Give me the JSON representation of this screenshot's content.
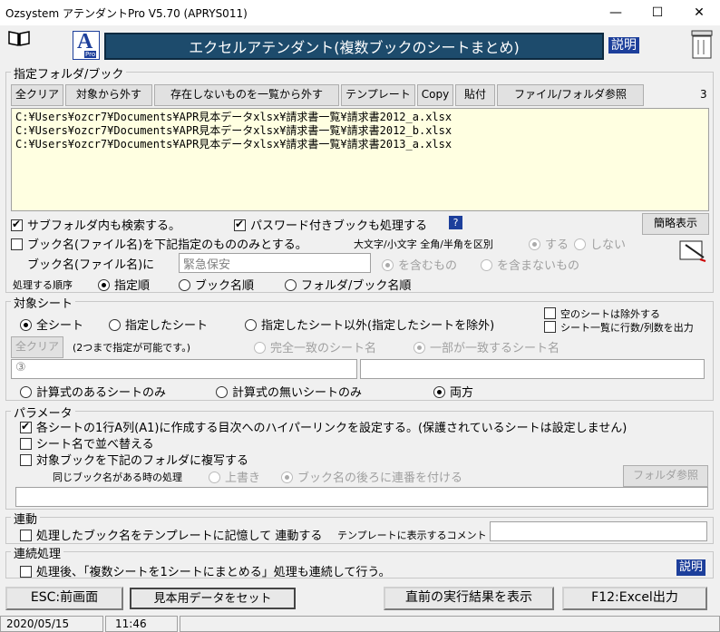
{
  "window": {
    "title": "Ozsystem アテンダントPro V5.70 (APRYS011)",
    "minimize": "—",
    "maximize": "☐",
    "close": "✕"
  },
  "header": {
    "banner": "エクセルアテンダント(複数ブックのシートまとめ)",
    "help_label": "説明",
    "logo_letter": "A",
    "logo_sub": "Pro"
  },
  "folder_section": {
    "label": "指定フォルダ/ブック",
    "buttons": [
      "全クリア",
      "対象から外す",
      "存在しないものを一覧から外す",
      "テンプレート",
      "Copy",
      "貼付",
      "ファイル/フォルダ参照"
    ],
    "count": "3",
    "files": [
      "C:¥Users¥ozcr7¥Documents¥APR見本データxlsx¥請求書一覧¥請求書2012_a.xlsx",
      "C:¥Users¥ozcr7¥Documents¥APR見本データxlsx¥請求書一覧¥請求書2012_b.xlsx",
      "C:¥Users¥ozcr7¥Documents¥APR見本データxlsx¥請求書一覧¥請求書2013_a.xlsx"
    ],
    "subfolder_search": "サブフォルダ内も検索する。",
    "password_books": "パスワード付きブックも処理する",
    "help_q": "?",
    "compact_button": "簡略表示",
    "name_only": "ブック名(ファイル名)を下記指定のもののみとする。",
    "case_label": "大文字/小文字 全角/半角を区別",
    "case_yes": "する",
    "case_no": "しない",
    "bookname_label": "ブック名(ファイル名)に",
    "bookname_value": "緊急保安",
    "contains": "を含むもの",
    "not_contains": "を含まないもの",
    "order_label": "処理する順序",
    "order_options": [
      "指定順",
      "ブック名順",
      "フォルダ/ブック名順"
    ]
  },
  "sheet_section": {
    "label": "対象シート",
    "all": "全シート",
    "specified": "指定したシート",
    "except": "指定したシート以外(指定したシートを除外)",
    "exclude_empty": "空のシートは除外する",
    "output_counts": "シート一覧に行数/列数を出力",
    "clear_button": "全クリア",
    "two_note": "(2つまで指定が可能です。)",
    "exact_match": "完全一致のシート名",
    "partial_match": "一部が一致するシート名",
    "input1_value": "③",
    "formula_only": "計算式のあるシートのみ",
    "no_formula_only": "計算式の無いシートのみ",
    "both": "両方"
  },
  "param_section": {
    "label": "パラメータ",
    "hyperlink": "各シートの1行A列(A1)に作成する目次へのハイパーリンクを設定する。(保護されているシートは設定しません)",
    "sort_by_name": "シート名で並べ替える",
    "copy_book": "対象ブックを下記のフォルダに複写する",
    "same_name_label": "同じブック名がある時の処理",
    "overwrite": "上書き",
    "append_serial": "ブック名の後ろに連番を付ける",
    "folder_button": "フォルダ参照"
  },
  "link_section": {
    "label": "連動",
    "remember": "処理したブック名をテンプレートに記憶して 連動する",
    "comment_label": "テンプレートに表示するコメント"
  },
  "continuous_section": {
    "label": "連続処理",
    "continue_text": "処理後、「複数シートを1シートにまとめる」処理も連続して行う。",
    "help_label": "説明"
  },
  "footer": {
    "back": "ESC:前画面",
    "sample": "見本用データをセット",
    "last_result": "直前の実行結果を表示",
    "excel_out": "F12:Excel出力",
    "date": "2020/05/15",
    "time": "11:46"
  }
}
